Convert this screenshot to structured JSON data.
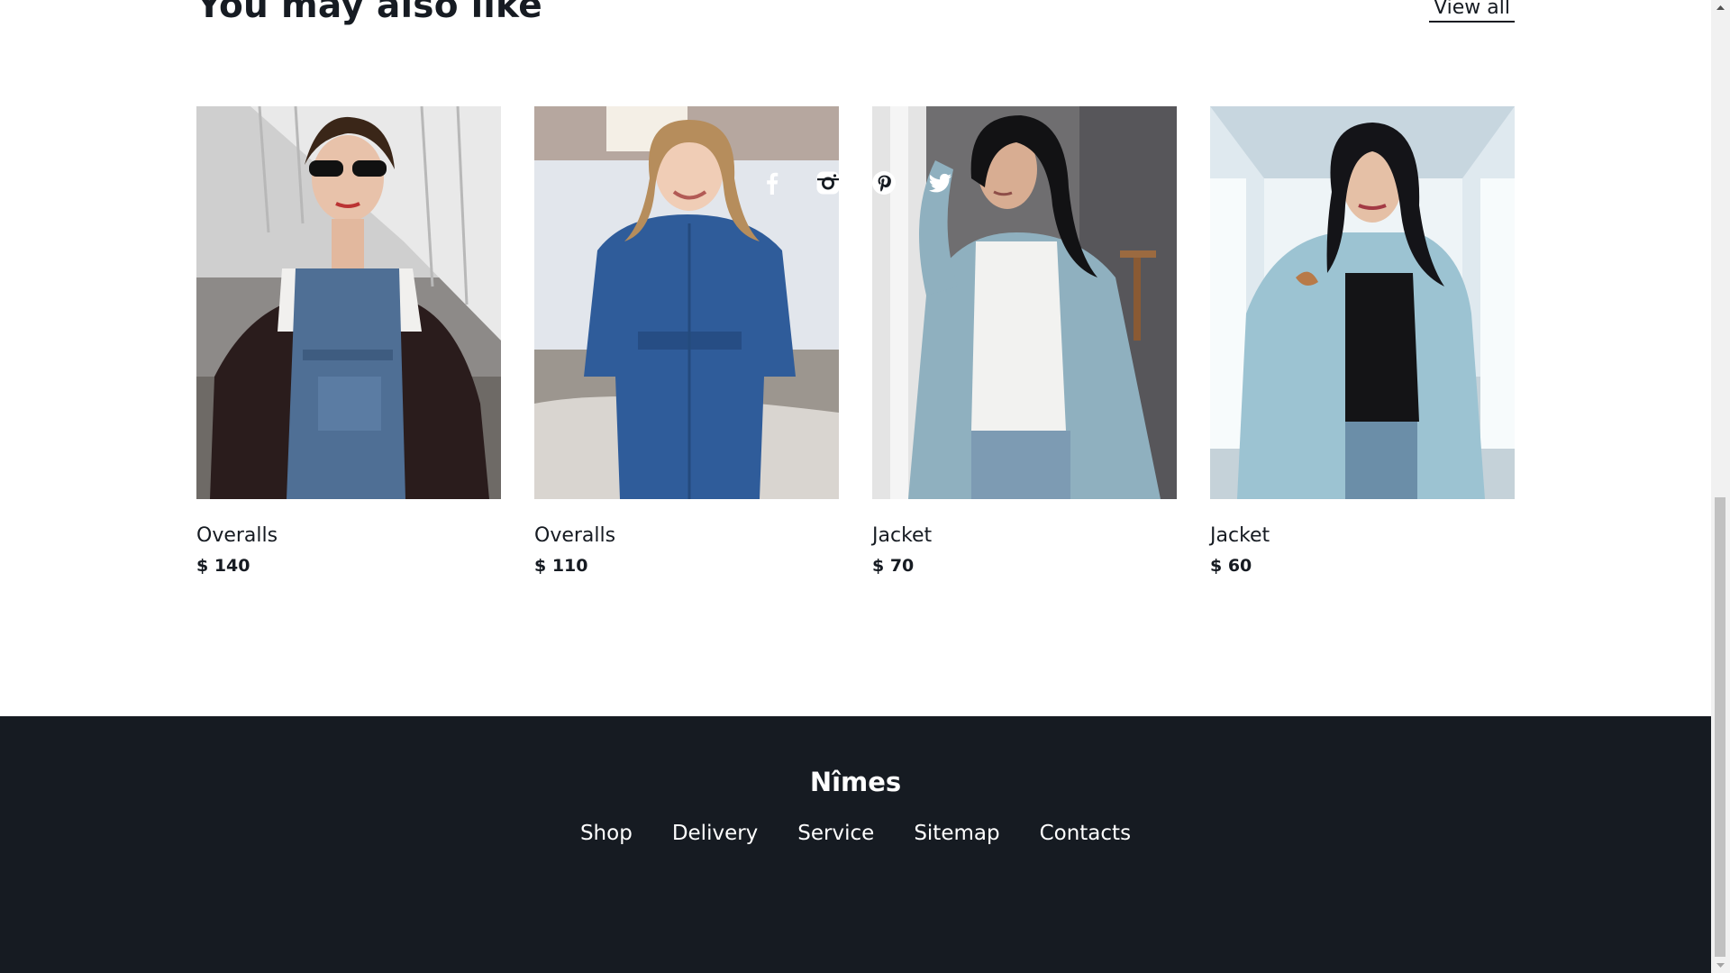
{
  "section": {
    "title": "You may also like",
    "view_all": "View all"
  },
  "products": [
    {
      "name": "Overalls",
      "price": "$ 140",
      "image": "woman in sunglasses wearing denim overalls"
    },
    {
      "name": "Overalls",
      "price": "$ 110",
      "image": "smiling woman in denim jumpsuit"
    },
    {
      "name": "Jacket",
      "price": "$ 70",
      "image": "woman in light denim jacket and white tee"
    },
    {
      "name": "Jacket",
      "price": "$ 60",
      "image": "woman in light denim jacket in white tunnel"
    }
  ],
  "footer": {
    "brand": "Nîmes",
    "links": [
      "Shop",
      "Delivery",
      "Service",
      "Sitemap",
      "Contacts"
    ],
    "social": [
      "facebook-icon",
      "instagram-icon",
      "pinterest-icon",
      "twitter-icon"
    ]
  },
  "colors": {
    "text": "#161b22",
    "footer_bg": "#161b22",
    "page_bg": "#ffffff"
  }
}
